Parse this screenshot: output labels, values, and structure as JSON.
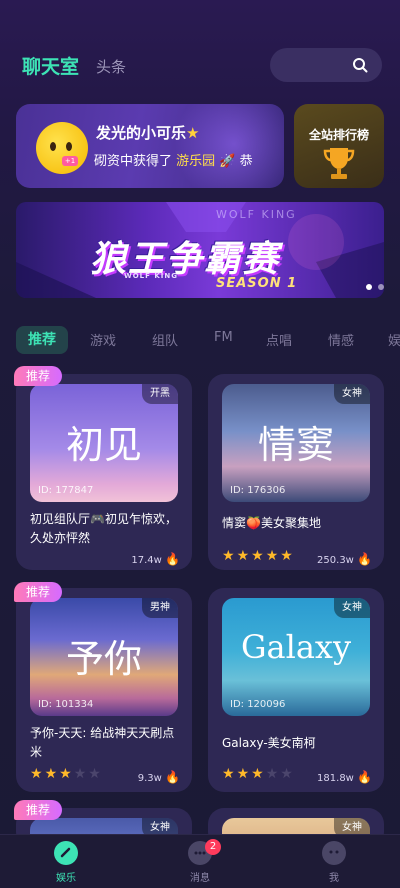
{
  "header": {
    "tab_active": "聊天室",
    "tab_inactive": "头条",
    "search_icon": "search-icon"
  },
  "welcome": {
    "name": "发光的小可乐",
    "name_icon": "star-icon",
    "message_prefix": "砌资中获得了",
    "message_highlight": "游乐园",
    "message_suffix": "恭"
  },
  "ranking": {
    "label": "全站排行榜",
    "icon": "trophy-icon"
  },
  "event_banner": {
    "title": "狼王争霸赛",
    "subtitle": "SEASON 1",
    "brand": "WOLF KING",
    "brand_small": "WOLF KING"
  },
  "categories": [
    "推荐",
    "游戏",
    "组队",
    "FM",
    "点唱",
    "情感",
    "娱"
  ],
  "rooms": [
    {
      "badge": "推荐",
      "thumb_title": "初见",
      "thumb_tag": "开黑",
      "id_label": "ID: 177847",
      "name": "初见组队厅🎮初见乍惊欢，久处亦怦然",
      "count": "17.4w",
      "rating": 0
    },
    {
      "badge": "",
      "thumb_title": "情窦",
      "thumb_tag": "女神",
      "id_label": "ID: 176306",
      "name": "情窦🍑美女聚集地",
      "count": "250.3w",
      "rating": 5
    },
    {
      "badge": "推荐",
      "thumb_title": "予你",
      "thumb_tag": "男神",
      "id_label": "ID: 101334",
      "name": "予你-天天: 给战神天天刷点米",
      "count": "9.3w",
      "rating": 3
    },
    {
      "badge": "",
      "thumb_title": "Galaxy",
      "thumb_tag": "女神",
      "id_label": "ID: 120096",
      "name": "Galaxy-美女南柯",
      "count": "181.8w",
      "rating": 3
    },
    {
      "badge": "推荐",
      "thumb_tag": "女神"
    },
    {
      "badge": "",
      "thumb_tag": "女神"
    }
  ],
  "bottom_nav": [
    {
      "label": "娱乐",
      "icon": "entertainment-icon",
      "active": true
    },
    {
      "label": "消息",
      "icon": "message-icon",
      "badge": "2"
    },
    {
      "label": "我",
      "icon": "profile-icon"
    }
  ],
  "colors": {
    "accent": "#3de3b5",
    "badge_pink": "#ff7ab8",
    "star": "#ffb92a",
    "background": "#1d1a3a"
  }
}
